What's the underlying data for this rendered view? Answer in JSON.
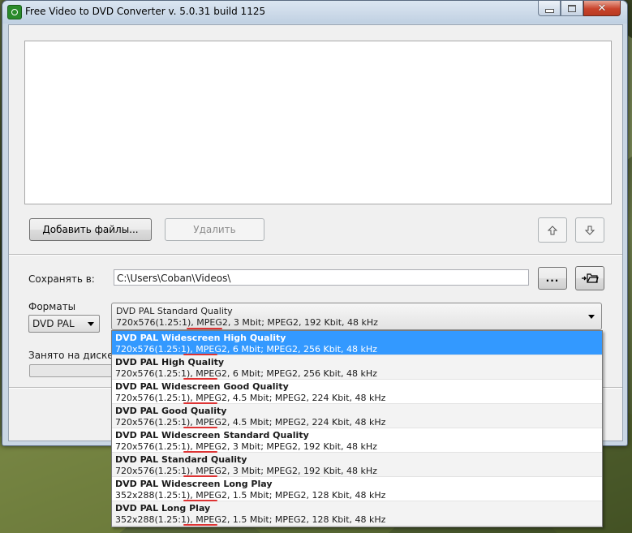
{
  "window": {
    "title": "Free Video to DVD Converter  v. 5.0.31 build 1125",
    "close_glyph": "✕"
  },
  "toolbar": {
    "add_files_label": "Добавить файлы...",
    "remove_label": "Удалить",
    "up_icon": "arrow-up-icon",
    "down_icon": "arrow-down-icon"
  },
  "save": {
    "label": "Сохранять в:",
    "path": "C:\\Users\\Coban\\Videos\\",
    "browse_label": "...",
    "open_icon": "folder-open-icon"
  },
  "formats": {
    "label": "Форматы",
    "selected": "DVD PAL"
  },
  "disk": {
    "label": "Занято на диске:"
  },
  "quality": {
    "selected_name": "DVD PAL Standard Quality",
    "selected_spec": "720x576(1.25:1), MPEG2, 3 Mbit; MPEG2, 192 Kbit, 48 kHz",
    "options": [
      {
        "name": "DVD PAL Widescreen High Quality",
        "spec": "720x576(1.25:1), MPEG2, 6 Mbit; MPEG2, 256 Kbit, 48 kHz"
      },
      {
        "name": "DVD PAL High Quality",
        "spec": "720x576(1.25:1), MPEG2, 6 Mbit; MPEG2, 256 Kbit, 48 kHz"
      },
      {
        "name": "DVD PAL Widescreen Good Quality",
        "spec": "720x576(1.25:1), MPEG2, 4.5 Mbit; MPEG2, 224 Kbit, 48 kHz"
      },
      {
        "name": "DVD PAL Good Quality",
        "spec": "720x576(1.25:1), MPEG2, 4.5 Mbit; MPEG2, 224 Kbit, 48 kHz"
      },
      {
        "name": "DVD PAL Widescreen Standard Quality",
        "spec": "720x576(1.25:1), MPEG2, 3 Mbit; MPEG2, 192 Kbit, 48 kHz"
      },
      {
        "name": "DVD PAL Standard Quality",
        "spec": "720x576(1.25:1), MPEG2, 3 Mbit; MPEG2, 192 Kbit, 48 kHz"
      },
      {
        "name": "DVD PAL Widescreen Long Play",
        "spec": "352x288(1.25:1), MPEG2, 1.5 Mbit; MPEG2, 128 Kbit, 48 kHz"
      },
      {
        "name": "DVD PAL Long Play",
        "spec": "352x288(1.25:1), MPEG2, 1.5 Mbit; MPEG2, 128 Kbit, 48 kHz"
      }
    ],
    "highlighted_index": 0
  },
  "colors": {
    "selection": "#3399ff",
    "annotation_underline": "#dd3333"
  }
}
